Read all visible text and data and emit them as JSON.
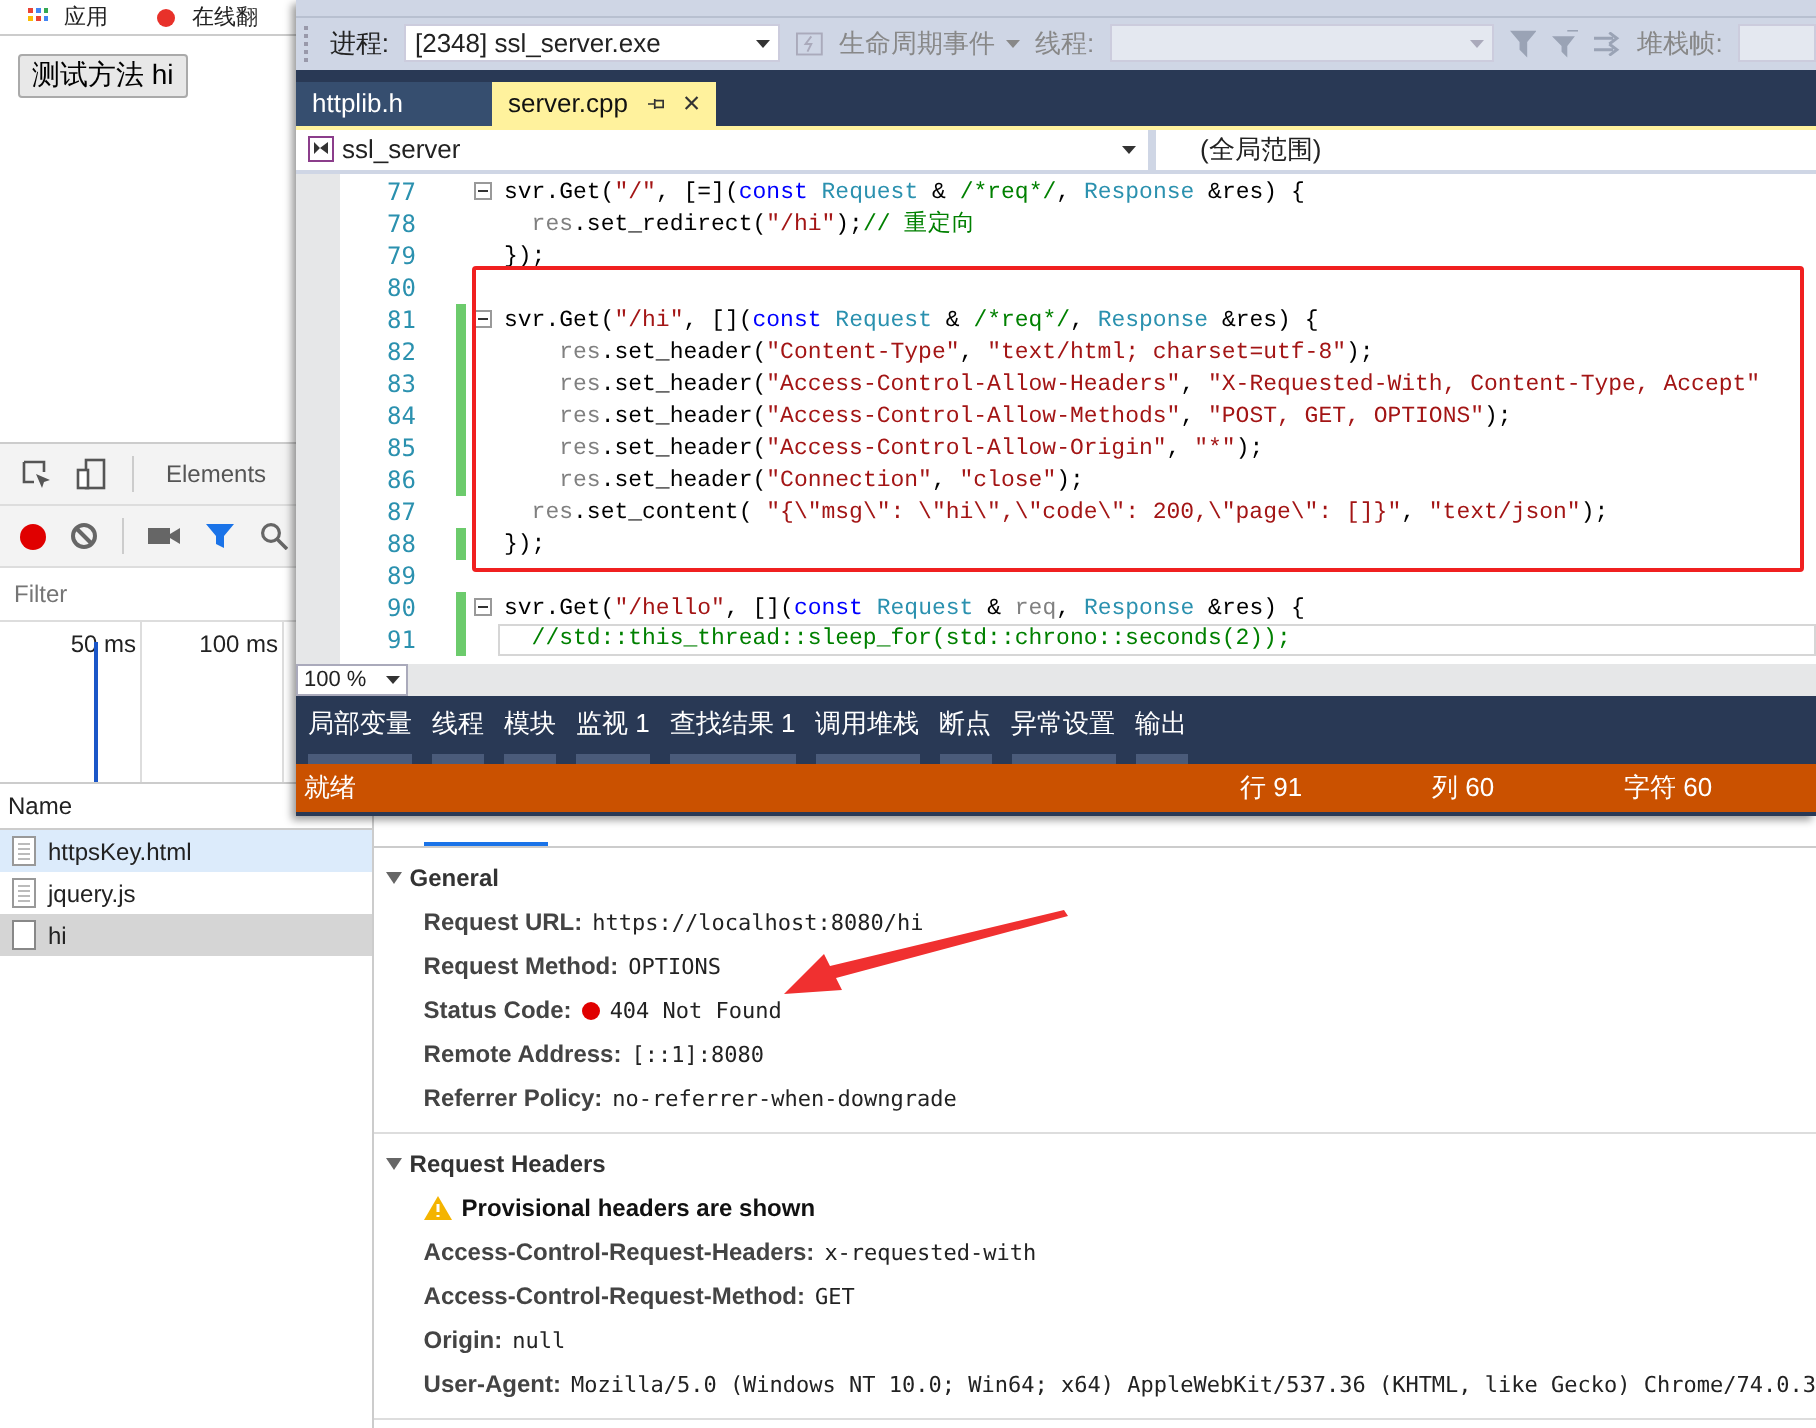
{
  "browser": {
    "bookmarks": [
      {
        "label": "应用",
        "kind": "apps"
      },
      {
        "label": "在线翻",
        "kind": "site"
      }
    ],
    "page_button": "测试方法 hi"
  },
  "devtools": {
    "elements_tab": "Elements",
    "recording": true,
    "filter_placeholder": "Filter",
    "timeline_ticks": [
      "50 ms",
      "100 ms"
    ],
    "name_header": "Name",
    "requests": [
      {
        "name": "httpsKey.html",
        "kind": "document",
        "selected": false,
        "hovered": true
      },
      {
        "name": "jquery.js",
        "kind": "document",
        "selected": false,
        "hovered": false
      },
      {
        "name": "hi",
        "kind": "blank",
        "selected": true,
        "hovered": false
      }
    ],
    "sections": [
      {
        "title": "General",
        "expanded": true,
        "rows": [
          {
            "label": "Request URL:",
            "value": "https://localhost:8080/hi"
          },
          {
            "label": "Request Method:",
            "value": "OPTIONS"
          },
          {
            "label": "Status Code:",
            "value": "404 Not Found",
            "color": "#e00000"
          },
          {
            "label": "Remote Address:",
            "value": "[::1]:8080"
          },
          {
            "label": "Referrer Policy:",
            "value": "no-referrer-when-downgrade"
          }
        ]
      },
      {
        "title": "Request Headers",
        "expanded": true,
        "warning": "Provisional headers are shown",
        "rows": [
          {
            "label": "Access-Control-Request-Headers:",
            "value": "x-requested-with"
          },
          {
            "label": "Access-Control-Request-Method:",
            "value": "GET"
          },
          {
            "label": "Origin:",
            "value": "null"
          },
          {
            "label": "User-Agent:",
            "value": "Mozilla/5.0 (Windows NT 10.0; Win64; x64) AppleWebKit/537.36 (KHTML, like Gecko) Chrome/74.0.3"
          }
        ]
      }
    ]
  },
  "ide": {
    "toolbar": {
      "process_label": "进程:",
      "process": "[2348] ssl_server.exe",
      "lifecycle": "生命周期事件",
      "thread_label": "线程:",
      "stackframe_label": "堆栈帧:"
    },
    "tabs": [
      {
        "label": "httplib.h",
        "selected": false
      },
      {
        "label": "server.cpp",
        "selected": true
      }
    ],
    "scope": "ssl_server",
    "global_scope": "(全局范围)",
    "code_lines": [
      {
        "number": "77",
        "fold": true,
        "changed": false,
        "current": false,
        "tokens": [
          {
            "kind": "plain",
            "text": "svr.Get("
          },
          {
            "kind": "string",
            "text": "\"/\""
          },
          {
            "kind": "plain",
            "text": ", [=]("
          },
          {
            "kind": "keyword",
            "text": "const "
          },
          {
            "kind": "type",
            "text": "Request"
          },
          {
            "kind": "plain",
            "text": " & "
          },
          {
            "kind": "comment",
            "text": "/*req*/"
          },
          {
            "kind": "plain",
            "text": ", "
          },
          {
            "kind": "type",
            "text": "Response"
          },
          {
            "kind": "plain",
            "text": " &res) {"
          }
        ]
      },
      {
        "number": "78",
        "fold": false,
        "changed": false,
        "current": false,
        "tokens": [
          {
            "kind": "param",
            "text": "  res"
          },
          {
            "kind": "plain",
            "text": ".set_redirect("
          },
          {
            "kind": "string",
            "text": "\"/hi\""
          },
          {
            "kind": "plain",
            "text": ");"
          },
          {
            "kind": "comment",
            "text": "// 重定向"
          }
        ]
      },
      {
        "number": "79",
        "fold": false,
        "changed": false,
        "current": false,
        "tokens": [
          {
            "kind": "plain",
            "text": "});"
          }
        ]
      },
      {
        "number": "80",
        "fold": false,
        "changed": false,
        "current": false
      },
      {
        "number": "81",
        "fold": true,
        "changed": true,
        "current": false,
        "tokens": [
          {
            "kind": "plain",
            "text": "svr.Get("
          },
          {
            "kind": "string",
            "text": "\"/hi\""
          },
          {
            "kind": "plain",
            "text": ", []("
          },
          {
            "kind": "keyword",
            "text": "const "
          },
          {
            "kind": "type",
            "text": "Request"
          },
          {
            "kind": "plain",
            "text": " & "
          },
          {
            "kind": "comment",
            "text": "/*req*/"
          },
          {
            "kind": "plain",
            "text": ", "
          },
          {
            "kind": "type",
            "text": "Response"
          },
          {
            "kind": "plain",
            "text": " &res) {"
          }
        ]
      },
      {
        "number": "82",
        "fold": false,
        "changed": true,
        "current": false,
        "tokens": [
          {
            "kind": "param",
            "text": "    res"
          },
          {
            "kind": "plain",
            "text": ".set_header("
          },
          {
            "kind": "string",
            "text": "\"Content-Type\""
          },
          {
            "kind": "plain",
            "text": ", "
          },
          {
            "kind": "string",
            "text": "\"text/html; charset=utf-8\""
          },
          {
            "kind": "plain",
            "text": ");"
          }
        ]
      },
      {
        "number": "83",
        "fold": false,
        "changed": true,
        "current": false,
        "tokens": [
          {
            "kind": "param",
            "text": "    res"
          },
          {
            "kind": "plain",
            "text": ".set_header("
          },
          {
            "kind": "string",
            "text": "\"Access-Control-Allow-Headers\""
          },
          {
            "kind": "plain",
            "text": ", "
          },
          {
            "kind": "string",
            "text": "\"X-Requested-With, Content-Type, Accept\""
          }
        ]
      },
      {
        "number": "84",
        "fold": false,
        "changed": true,
        "current": false,
        "tokens": [
          {
            "kind": "param",
            "text": "    res"
          },
          {
            "kind": "plain",
            "text": ".set_header("
          },
          {
            "kind": "string",
            "text": "\"Access-Control-Allow-Methods\""
          },
          {
            "kind": "plain",
            "text": ", "
          },
          {
            "kind": "string",
            "text": "\"POST, GET, OPTIONS\""
          },
          {
            "kind": "plain",
            "text": ");"
          }
        ]
      },
      {
        "number": "85",
        "fold": false,
        "changed": true,
        "current": false,
        "tokens": [
          {
            "kind": "param",
            "text": "    res"
          },
          {
            "kind": "plain",
            "text": ".set_header("
          },
          {
            "kind": "string",
            "text": "\"Access-Control-Allow-Origin\""
          },
          {
            "kind": "plain",
            "text": ", "
          },
          {
            "kind": "string",
            "text": "\"*\""
          },
          {
            "kind": "plain",
            "text": ");"
          }
        ]
      },
      {
        "number": "86",
        "fold": false,
        "changed": true,
        "current": false,
        "tokens": [
          {
            "kind": "param",
            "text": "    res"
          },
          {
            "kind": "plain",
            "text": ".set_header("
          },
          {
            "kind": "string",
            "text": "\"Connection\""
          },
          {
            "kind": "plain",
            "text": ", "
          },
          {
            "kind": "string",
            "text": "\"close\""
          },
          {
            "kind": "plain",
            "text": ");"
          }
        ]
      },
      {
        "number": "87",
        "fold": false,
        "changed": false,
        "current": false,
        "tokens": [
          {
            "kind": "param",
            "text": "  res"
          },
          {
            "kind": "plain",
            "text": ".set_content( "
          },
          {
            "kind": "string",
            "text": "\"{\\\"msg\\\": \\\"hi\\\",\\\"code\\\": 200,\\\"page\\\": []}\""
          },
          {
            "kind": "plain",
            "text": ", "
          },
          {
            "kind": "string",
            "text": "\"text/json\""
          },
          {
            "kind": "plain",
            "text": ");"
          }
        ]
      },
      {
        "number": "88",
        "fold": false,
        "changed": true,
        "current": false,
        "tokens": [
          {
            "kind": "plain",
            "text": "});"
          }
        ]
      },
      {
        "number": "89",
        "fold": false,
        "changed": false,
        "current": false
      },
      {
        "number": "90",
        "fold": true,
        "changed": true,
        "current": false,
        "tokens": [
          {
            "kind": "plain",
            "text": "svr.Get("
          },
          {
            "kind": "string",
            "text": "\"/hello\""
          },
          {
            "kind": "plain",
            "text": ", []("
          },
          {
            "kind": "keyword",
            "text": "const "
          },
          {
            "kind": "type",
            "text": "Request"
          },
          {
            "kind": "plain",
            "text": " & "
          },
          {
            "kind": "param",
            "text": "req"
          },
          {
            "kind": "plain",
            "text": ", "
          },
          {
            "kind": "type",
            "text": "Response"
          },
          {
            "kind": "plain",
            "text": " &res) {"
          }
        ]
      },
      {
        "number": "91",
        "fold": false,
        "changed": true,
        "current": true,
        "tokens": [
          {
            "kind": "comment",
            "text": "  //std::this_thread::sleep_for(std::chrono::seconds(2));"
          }
        ]
      }
    ],
    "zoom": "100 %",
    "tool_tabs": [
      "局部变量",
      "线程",
      "模块",
      "监视 1",
      "查找结果 1",
      "调用堆栈",
      "断点",
      "异常设置",
      "输出"
    ],
    "status_bar": {
      "state": "就绪",
      "line": "行 91",
      "column": "列 60",
      "char": "字符 60"
    }
  }
}
